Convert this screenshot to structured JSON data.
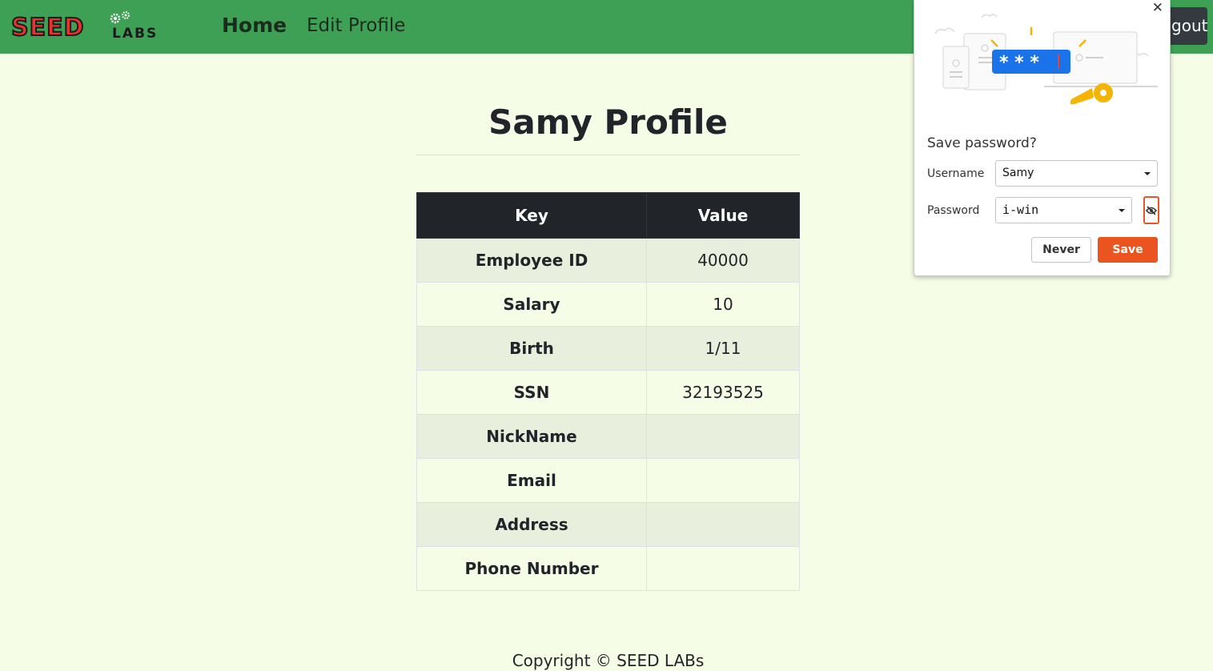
{
  "navbar": {
    "logo_main": "SEED",
    "logo_sub": "LABS",
    "links": [
      {
        "label": "Home"
      },
      {
        "label": "Edit Profile"
      }
    ],
    "logout_label": "Logout"
  },
  "page": {
    "title": "Samy Profile",
    "table": {
      "headers": [
        "Key",
        "Value"
      ],
      "rows": [
        {
          "key": "Employee ID",
          "value": "40000"
        },
        {
          "key": "Salary",
          "value": "10"
        },
        {
          "key": "Birth",
          "value": "1/11"
        },
        {
          "key": "SSN",
          "value": "32193525"
        },
        {
          "key": "NickName",
          "value": ""
        },
        {
          "key": "Email",
          "value": ""
        },
        {
          "key": "Address",
          "value": ""
        },
        {
          "key": "Phone Number",
          "value": ""
        }
      ]
    },
    "copyright": "Copyright © SEED LABs"
  },
  "password_popup": {
    "close_glyph": "✕",
    "heading": "Save password?",
    "username_label": "Username",
    "username_value": "Samy",
    "password_label": "Password",
    "password_value": "i-win",
    "never_label": "Never",
    "save_label": "Save",
    "accent_color": "#e95420"
  },
  "colors": {
    "navbar": "#3ea055",
    "page_background": "#f5fde6",
    "table_header": "#212529"
  }
}
